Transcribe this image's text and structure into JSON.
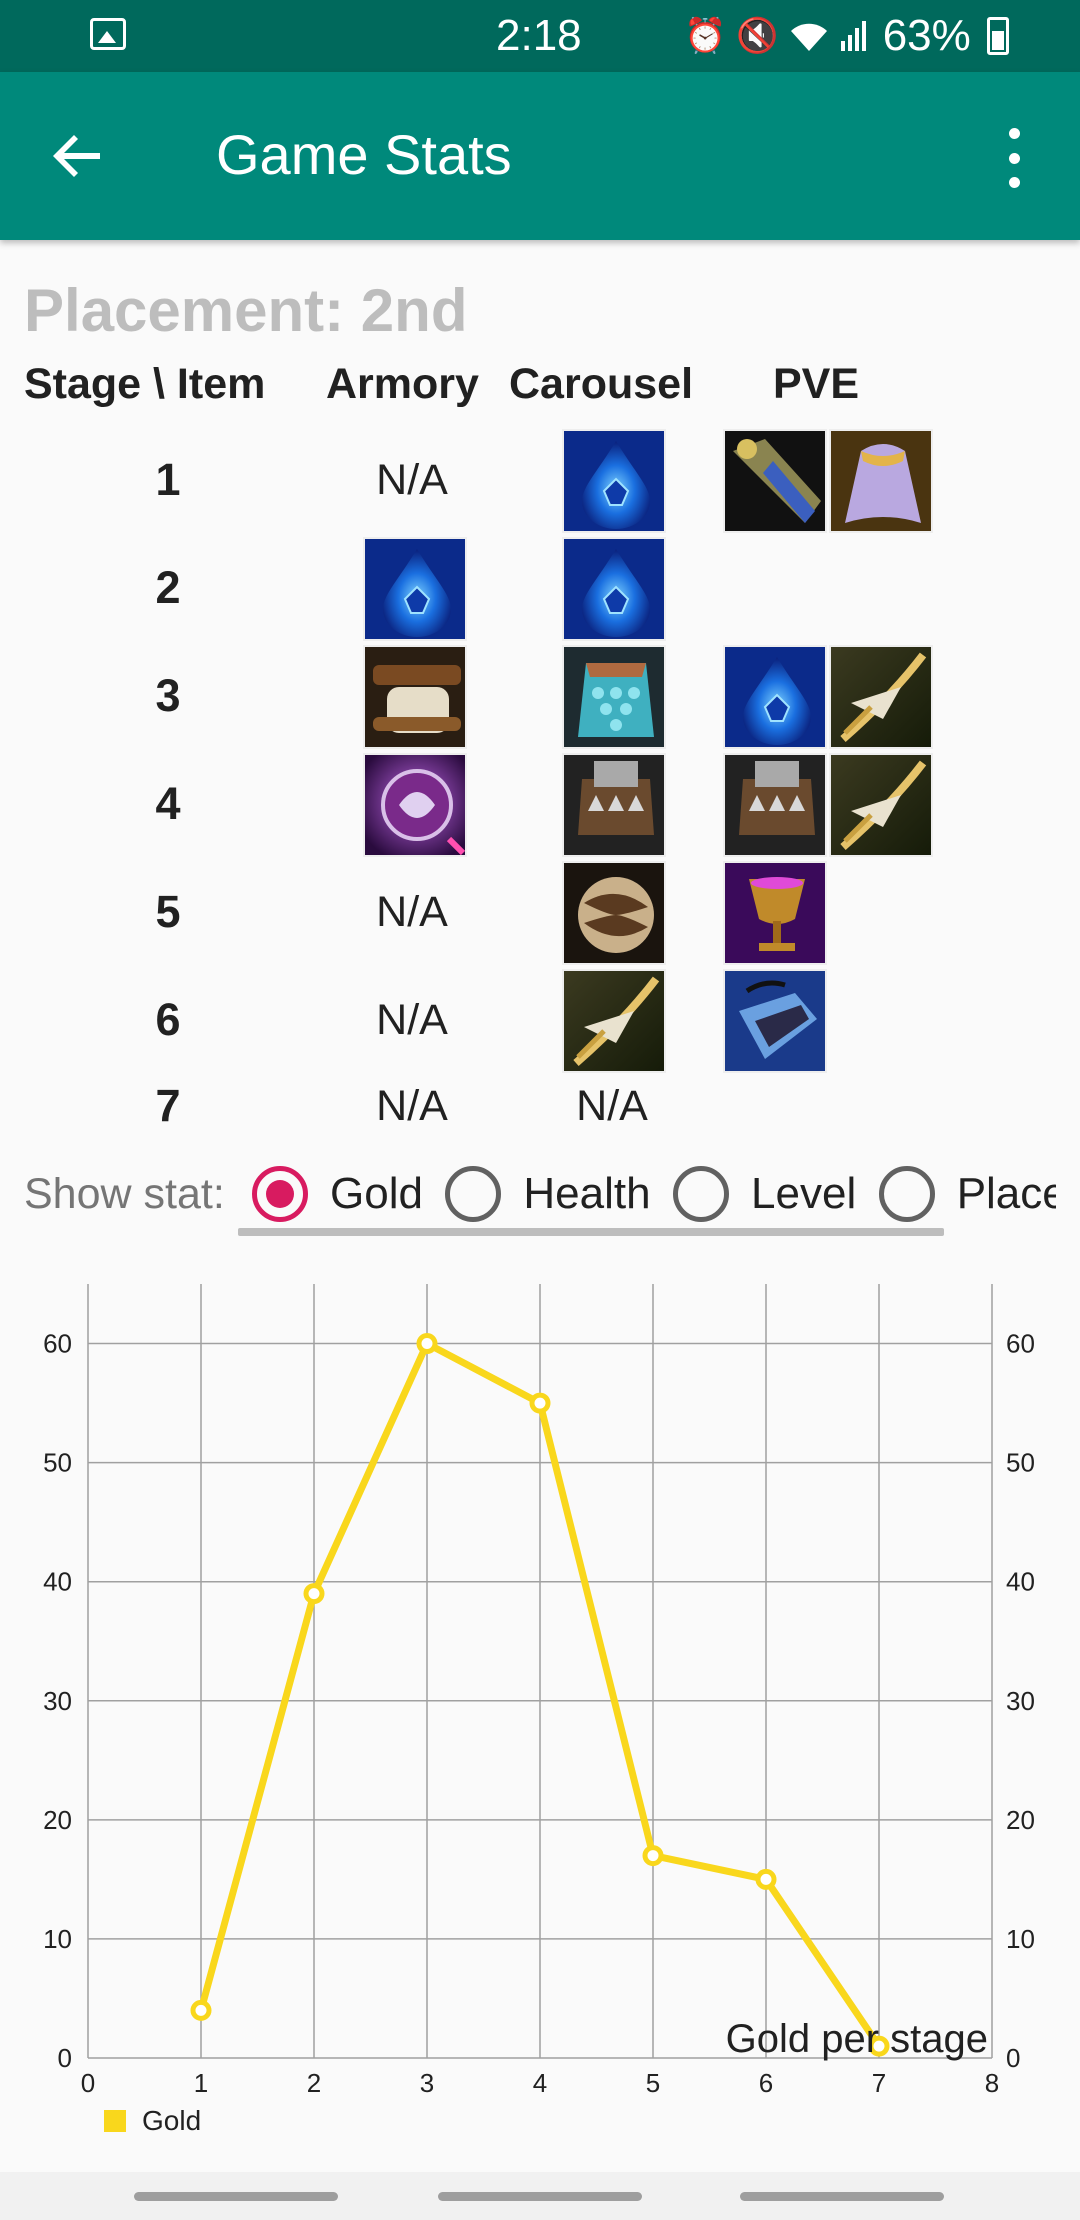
{
  "status_bar": {
    "time": "2:18",
    "battery": "63%",
    "icons": [
      "image-icon",
      "alarm-icon",
      "mute-icon",
      "wifi-icon",
      "signal-icon",
      "battery-icon"
    ]
  },
  "app_bar": {
    "title": "Game Stats",
    "back_icon": "arrow-back-icon",
    "menu_icon": "more-vert-icon"
  },
  "placement": "Placement: 2nd",
  "table": {
    "headers": [
      "Stage \\ Item",
      "Armory",
      "Carousel",
      "PVE"
    ],
    "rows": [
      {
        "stage": "1",
        "armory": "N/A",
        "carousel": [
          "tear-of-the-goddess"
        ],
        "pve": [
          "spatula",
          "cloak"
        ]
      },
      {
        "stage": "2",
        "armory": [
          "tear-of-the-goddess"
        ],
        "carousel": [
          "tear-of-the-goddess"
        ],
        "pve": []
      },
      {
        "stage": "3",
        "armory": [
          "sparring-gloves"
        ],
        "carousel": [
          "dragons-claw"
        ],
        "pve": [
          "tear-of-the-goddess",
          "recurve-bow"
        ]
      },
      {
        "stage": "4",
        "armory": [
          "hand-of-justice"
        ],
        "carousel": [
          "chain-vest"
        ],
        "pve": [
          "chain-vest",
          "recurve-bow"
        ]
      },
      {
        "stage": "5",
        "armory": "N/A",
        "carousel": [
          "force-of-nature"
        ],
        "pve": [
          "chalice"
        ]
      },
      {
        "stage": "6",
        "armory": "N/A",
        "carousel": [
          "recurve-bow"
        ],
        "pve": [
          "zephyr"
        ]
      },
      {
        "stage": "7",
        "armory": "N/A",
        "carousel": "N/A",
        "pve": []
      }
    ]
  },
  "stat_selector": {
    "label": "Show stat:",
    "options": [
      "Gold",
      "Health",
      "Level",
      "Place"
    ],
    "selected": "Gold",
    "accent_color": "#d81b60"
  },
  "chart_data": {
    "type": "line",
    "x": [
      1,
      2,
      3,
      4,
      5,
      6,
      7
    ],
    "series": [
      {
        "name": "Gold",
        "values": [
          4,
          39,
          60,
          55,
          17,
          15,
          1
        ],
        "color": "#f9d71c"
      }
    ],
    "xlim": [
      0,
      8
    ],
    "ylim": [
      0,
      65
    ],
    "x_ticks": [
      "0",
      "1",
      "2",
      "3",
      "4",
      "5",
      "6",
      "7",
      "8"
    ],
    "y_ticks": [
      "0",
      "10",
      "20",
      "30",
      "40",
      "50",
      "60"
    ],
    "description": "Gold per stage",
    "grid": true,
    "legend": "bottom-left"
  },
  "colors": {
    "status_bar": "#00695c",
    "app_bar": "#00897b",
    "line": "#f9d71c"
  }
}
